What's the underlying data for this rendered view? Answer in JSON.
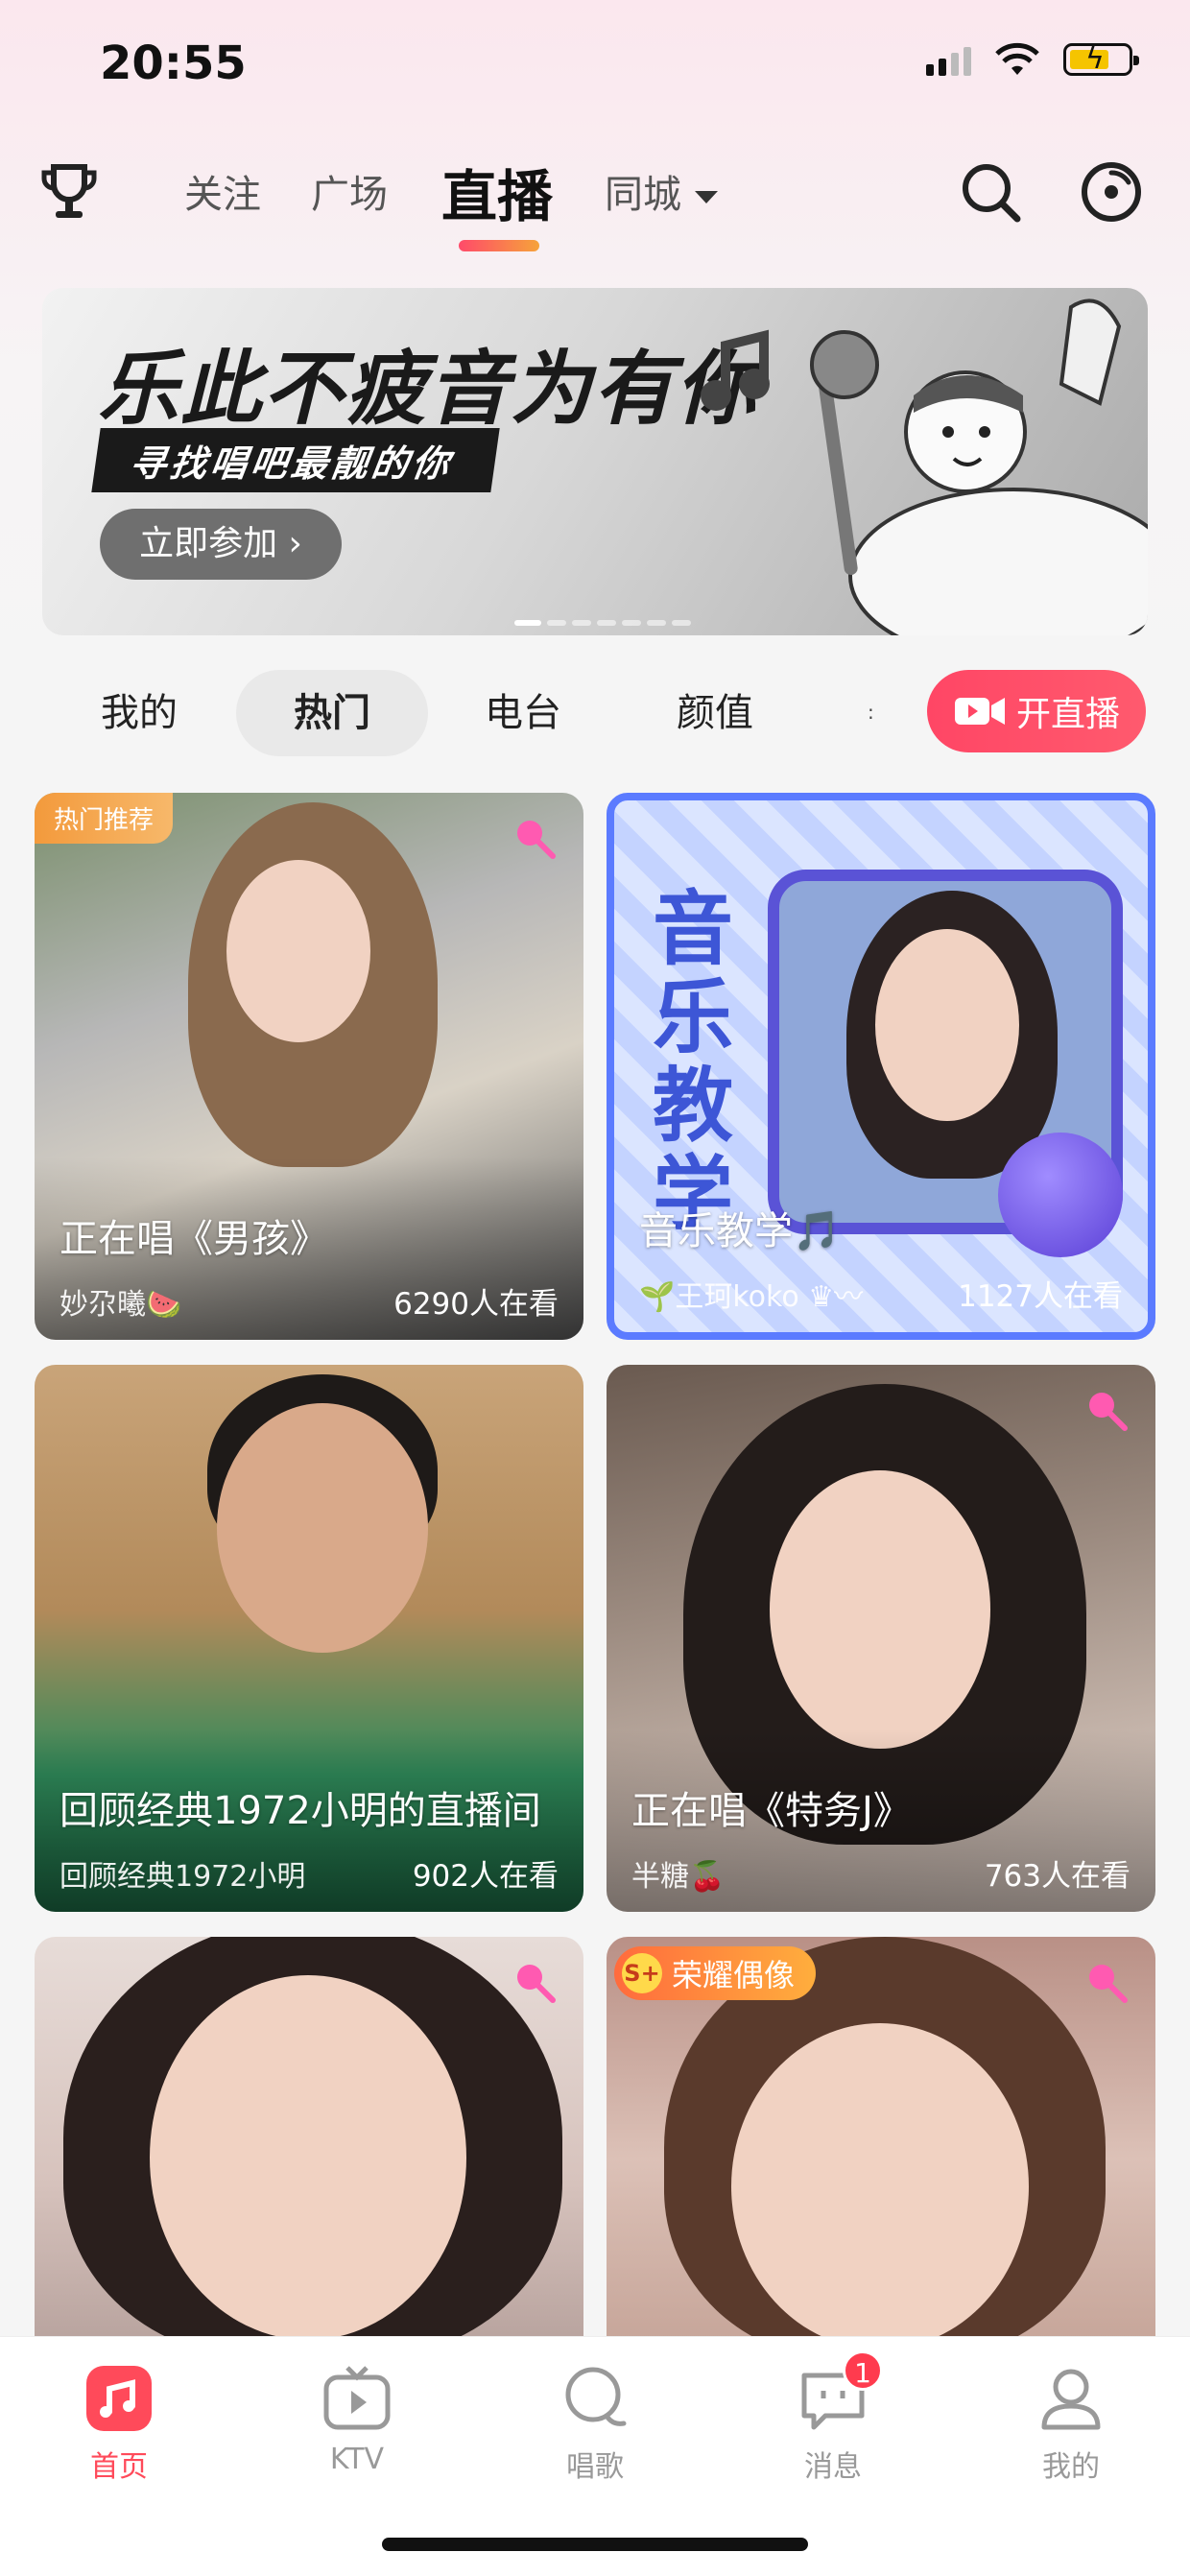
{
  "status_bar": {
    "time": "20:55"
  },
  "nav": {
    "tabs": [
      {
        "label": "关注"
      },
      {
        "label": "广场"
      },
      {
        "label": "直播"
      },
      {
        "label": "同城"
      }
    ]
  },
  "banner": {
    "title": "乐此不疲音为有你",
    "subtitle": "寻找唱吧最靓的你",
    "button": "立即参加 ›"
  },
  "categories": {
    "items": [
      "我的",
      "热门",
      "电台",
      "颜值"
    ],
    "live_button": "开直播"
  },
  "cards": [
    {
      "title": "正在唱《男孩》",
      "host": "妙尕曦🍉",
      "viewers": "6290人在看",
      "badge": "热门推荐"
    },
    {
      "title": "音乐教学🎵",
      "host": "🌱王珂koko ♛〰",
      "viewers": "1127人在看",
      "vertical_text": "音乐教学"
    },
    {
      "title": "回顾经典1972小明的直播间",
      "host": "回顾经典1972小明",
      "viewers": "902人在看"
    },
    {
      "title": "正在唱《特务J》",
      "host": "半糖🍒",
      "viewers": "763人在看"
    },
    {
      "title": "",
      "host": "",
      "viewers": ""
    },
    {
      "title": "",
      "host": "",
      "viewers": "",
      "badge_icon": "S+",
      "badge": "荣耀偶像"
    }
  ],
  "tabbar": {
    "items": [
      {
        "label": "首页"
      },
      {
        "label": "KTV"
      },
      {
        "label": "唱歌"
      },
      {
        "label": "消息",
        "badge": "1"
      },
      {
        "label": "我的"
      }
    ]
  },
  "colors": {
    "accent": "#ff4a5a",
    "live_button": "#ff4665",
    "badge_orange": "#f39a3c"
  }
}
